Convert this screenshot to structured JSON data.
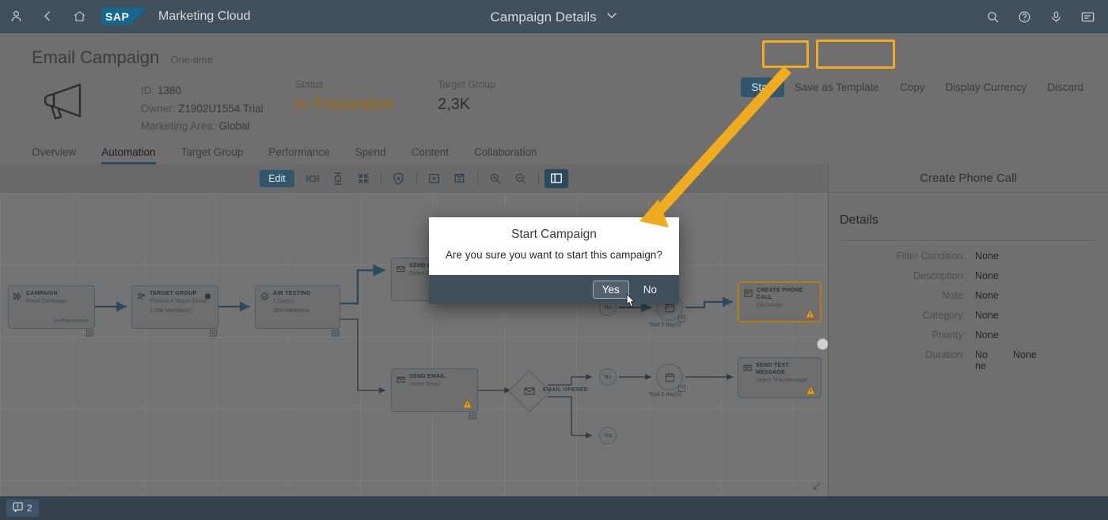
{
  "shellbar": {
    "product": "Marketing Cloud",
    "title": "Campaign Details",
    "logo_text": "SAP",
    "icons": {
      "user": "user-icon",
      "back": "back-icon",
      "home": "home-icon",
      "search": "search-icon",
      "help": "help-icon",
      "mic": "microphone-icon",
      "notes": "notifications-icon",
      "chevron": "chevron-down-icon"
    }
  },
  "header": {
    "title": "Email Campaign",
    "subtype": "One-time",
    "fields": {
      "id_label": "ID:",
      "id_value": "1380",
      "owner_label": "Owner:",
      "owner_value": "Z1902U1554 Trial",
      "area_label": "Marketing Area:",
      "area_value": "Global"
    },
    "columns": [
      {
        "key": "Status",
        "value": "In Preparation",
        "status": true
      },
      {
        "key": "Target Group",
        "value": "2,3K",
        "status": false
      }
    ],
    "actions": [
      {
        "label": "Start",
        "emphasized": true
      },
      {
        "label": "Save as Template",
        "emphasized": false
      },
      {
        "label": "Copy",
        "emphasized": false
      },
      {
        "label": "Display Currency",
        "emphasized": false
      },
      {
        "label": "Discard",
        "emphasized": false
      }
    ]
  },
  "tabs": [
    {
      "label": "Overview",
      "active": false
    },
    {
      "label": "Automation",
      "active": true
    },
    {
      "label": "Target Group",
      "active": false
    },
    {
      "label": "Performance",
      "active": false
    },
    {
      "label": "Spend",
      "active": false
    },
    {
      "label": "Content",
      "active": false
    },
    {
      "label": "Collaboration",
      "active": false
    }
  ],
  "canvas_toolbar": {
    "edit_label": "Edit",
    "icons": [
      "align-horizontal-icon",
      "align-vertical-icon",
      "collapse-all-icon",
      "validate-shield-icon",
      "add-node-icon",
      "schedule-icon",
      "zoom-in-icon",
      "zoom-out-icon",
      "toggle-side-panel-icon"
    ]
  },
  "flow": {
    "nodes": [
      {
        "id": "campaign",
        "type": "CAMPAIGN",
        "subtitle": "Email Campaign",
        "extra": "",
        "footer": "In Preparation",
        "warn": false,
        "selected": false
      },
      {
        "id": "target",
        "type": "TARGET GROUP",
        "subtitle": "Product A Target Group",
        "extra": "2.25K Member(s)",
        "footer": "",
        "warn": false,
        "selected": false
      },
      {
        "id": "abtest",
        "type": "A/B TESTING",
        "subtitle": "2 Day(s)",
        "extra": "20% Members",
        "footer": "",
        "warn": false,
        "selected": false
      },
      {
        "id": "email-a",
        "type": "SEND EMAIL",
        "subtitle": "Select Email",
        "extra": "",
        "footer": "",
        "warn": true,
        "selected": false
      },
      {
        "id": "email-b",
        "type": "SEND EMAIL",
        "subtitle": "Select Email",
        "extra": "",
        "footer": "",
        "warn": true,
        "selected": false
      },
      {
        "id": "phonecall",
        "type": "CREATE PHONE CALL",
        "subtitle": "Fill Details",
        "extra": "",
        "footer": "",
        "warn": true,
        "selected": true
      },
      {
        "id": "textmsg",
        "type": "SEND TEXT MESSAGE",
        "subtitle": "Select Text Message",
        "extra": "",
        "footer": "",
        "warn": true,
        "selected": false
      }
    ],
    "decision_label": "EMAIL OPENED",
    "branch_no": "No",
    "branch_yes": "Yes",
    "branch_no_2": "No",
    "wait_label_1": "Wait 5 day(s)",
    "wait_label_2": "Wait 5 day(s)"
  },
  "side_panel": {
    "title": "Create Phone Call",
    "section": "Details",
    "rows": [
      {
        "key": "Filter Condition:",
        "value": "None",
        "value2": ""
      },
      {
        "key": "Description:",
        "value": "None",
        "value2": ""
      },
      {
        "key": "Note:",
        "value": "None",
        "value2": ""
      },
      {
        "key": "Category:",
        "value": "None",
        "value2": ""
      },
      {
        "key": "Priority:",
        "value": "None",
        "value2": ""
      },
      {
        "key": "Duration:",
        "value": "No ne",
        "value2": "None"
      }
    ]
  },
  "dialog": {
    "title": "Start Campaign",
    "message": "Are you sure you want to start this campaign?",
    "confirm_label": "Yes",
    "cancel_label": "No"
  },
  "footer": {
    "message_count": "2",
    "message_icon": "message-popup-icon"
  },
  "colors": {
    "accent_blue": "#31566e",
    "highlight_yellow": "#f0ab1e",
    "status_orange": "#9a6a10",
    "warning_amber": "#e5a020",
    "shell_bg": "#40505c"
  }
}
